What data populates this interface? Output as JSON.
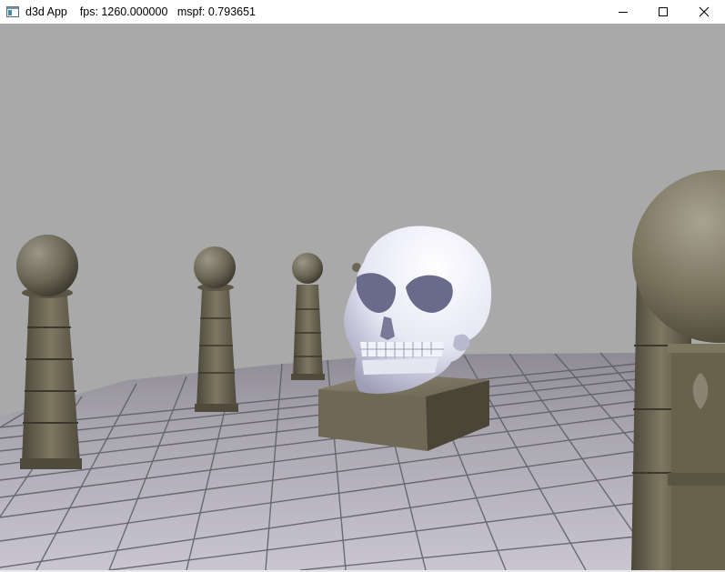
{
  "window": {
    "app_name": "d3d App",
    "fps_label": "fps: 1260.000000",
    "mspf_label": "mspf: 0.793651",
    "minimize_label": "Minimize",
    "maximize_label": "Maximize",
    "close_label": "Close"
  },
  "icons": {
    "app": "app-window-icon",
    "minimize": "minimize-icon",
    "maximize": "maximize-icon",
    "close": "close-icon"
  },
  "scene": {
    "background_color": "#a9a9a9",
    "floor_color": "#b4b2bc",
    "skull_color": "#e2e2f4",
    "stone_color": "#6f6a55"
  }
}
